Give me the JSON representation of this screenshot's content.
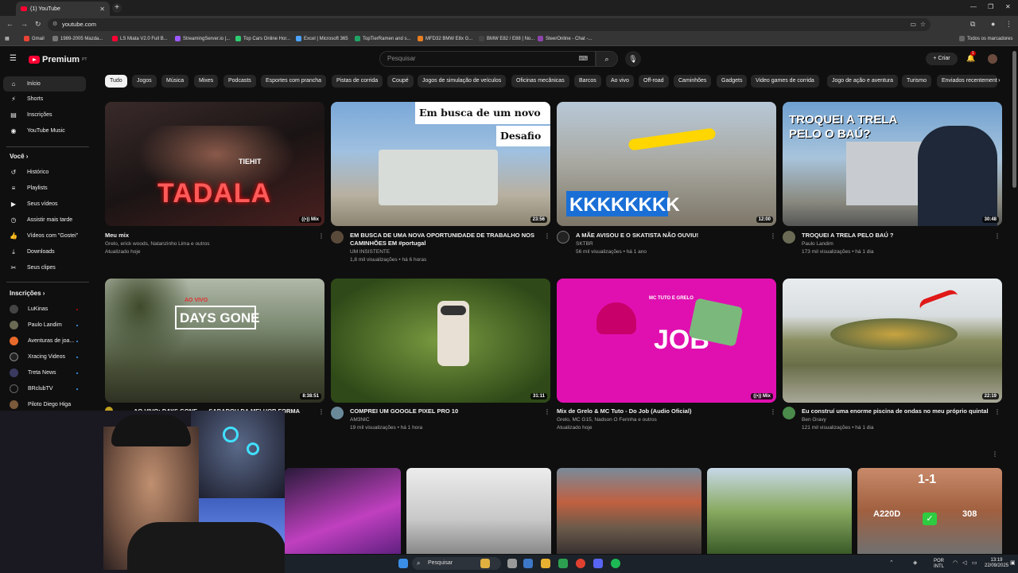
{
  "browser": {
    "tab_title": "(1) YouTube",
    "url": "youtube.com",
    "bookmarks": [
      "Gmail",
      "1989-2005 Mazda...",
      "LS Miata V2.0 Full B...",
      "StreamingServer.io |...",
      "Top Cars Online Hor...",
      "Excel | Microsoft 365",
      "TopTierRamen and s...",
      "MFD32 BMW E8x G...",
      "BMW E82 / E88 | No...",
      "SteerOnline - Chat -..."
    ],
    "all_bookmarks": "Todos os marcadores"
  },
  "header": {
    "logo": "Premium",
    "logo_region": "PT",
    "search_placeholder": "Pesquisar",
    "create": "Criar",
    "notif_count": "1"
  },
  "sidebar": {
    "main": [
      "Início",
      "Shorts",
      "Inscrições",
      "YouTube Music"
    ],
    "voce_heading": "Você",
    "voce": [
      "Histórico",
      "Playlists",
      "Seus vídeos",
      "Assistir mais tarde",
      "Vídeos com \"Gostei\"",
      "Downloads",
      "Seus clipes"
    ],
    "subs_heading": "Inscrições",
    "subs": [
      "LuKinas",
      "Paulo Landim",
      "Aventuras de joa...",
      "Xracing Videos",
      "Treta News",
      "BRclubTV",
      "Piloto Diego Higa"
    ]
  },
  "chips": [
    "Tudo",
    "Jogos",
    "Música",
    "Mixes",
    "Podcasts",
    "Esportes com prancha",
    "Pistas de corrida",
    "Coupé",
    "Jogos de simulação de veículos",
    "Oficinas mecânicas",
    "Barcos",
    "Ao vivo",
    "Off-road",
    "Caminhões",
    "Gadgets",
    "Video games de corrida",
    "Jogo de ação e aventura",
    "Turismo",
    "Enviados recentemente"
  ],
  "videos": [
    {
      "title": "Meu mix",
      "channel": "Grelo, erick woods, Natanzinho Lima e outros",
      "stats": "Atualizado hoje",
      "badge": "Mix",
      "overlay": "TADALA",
      "overlay2": "TIEHIT"
    },
    {
      "title": "EM BUSCA DE UMA NOVA OPORTUNIDADE DE TRABALHO NOS CAMINHÕES EM #portugal",
      "channel": "UM INSISTENTE",
      "stats": "1,8 mil visualizações • há 6 horas",
      "duration": "23:56",
      "overlay": "Em busca de um novo",
      "overlay2": "Desafio"
    },
    {
      "title": "A MÃE AVISOU E O SKATISTA NÃO OUVIU!",
      "channel": "SKTBR",
      "stats": "56 mil visualizações • há 1 ano",
      "duration": "12:00",
      "overlay": "KKKKKKKK"
    },
    {
      "title": "TROQUEI A TRELA PELO BAÚ ?",
      "channel": "Paulo Landim",
      "stats": "173 mil visualizações • há 1 dia",
      "duration": "30:48",
      "overlay": "TROQUEI A TRELA",
      "overlay2": "PELO O BAÚ?"
    },
    {
      "title": "AO VIVO: DAYS GONE ---- SABADOU DA MELHOR FORMA",
      "channel": "",
      "stats": "",
      "duration": "8:38:51",
      "overlay": "DAYS GONE",
      "overlay2": "AO VIVO"
    },
    {
      "title": "COMPREI UM GOOGLE PIXEL PRO 10",
      "channel": "AM3NIC",
      "stats": "19 mil visualizações • há 1 hora",
      "duration": "31:11"
    },
    {
      "title": "Mix de Grelo & MC Tuto - Do Job (Audio Oficial)",
      "channel": "Grelo, MC G15, Nadson O Ferinha e outros",
      "stats": "Atualizado hoje",
      "badge": "Mix",
      "overlay": "JOB",
      "overlay2": "MC TUTO E GRELO"
    },
    {
      "title": "Eu construí uma enorme piscina de ondas no meu próprio quintal",
      "channel": "Ben Gravy",
      "stats": "121 mil visualizações • há 1 dia",
      "duration": "22:19"
    }
  ],
  "row3": {
    "overlay_a": "A220D",
    "overlay_b": "308",
    "score": "1-1"
  },
  "taskbar": {
    "search": "Pesquisar",
    "lang1": "POR",
    "lang2": "INTL",
    "time": "13:19",
    "date": "22/09/2025"
  },
  "colors": {
    "bg": "#0f0f0f",
    "chip": "#272727",
    "accent": "#ff0033",
    "link": "#3ea6ff"
  }
}
